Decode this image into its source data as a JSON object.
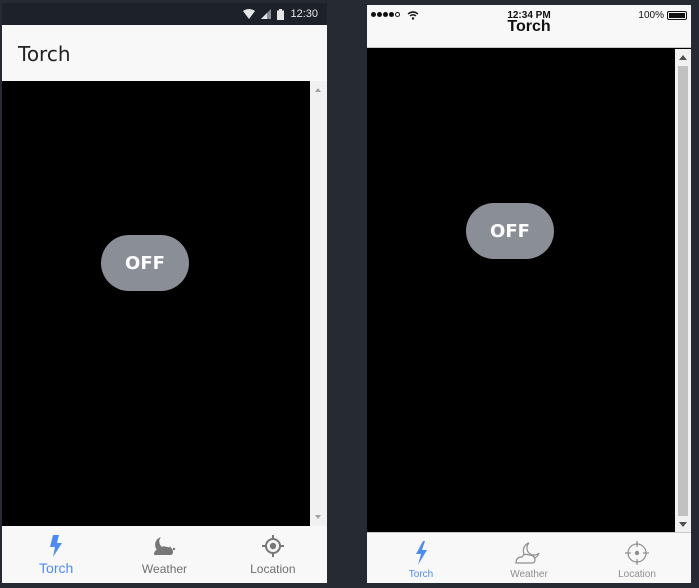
{
  "colors": {
    "accent": "#4e8cf0",
    "toggle_bg": "#8a8e96",
    "inactive_icon": "#777777",
    "desktop_bg": "#252a33"
  },
  "android": {
    "status_bar": {
      "time": "12:30",
      "icons": [
        "wifi-icon",
        "cell-signal-icon",
        "battery-icon"
      ]
    },
    "title": "Torch",
    "toggle_label": "OFF",
    "tabs": [
      {
        "label": "Torch",
        "icon": "lightning-bolt-icon",
        "active": true
      },
      {
        "label": "Weather",
        "icon": "weather-icon",
        "active": false
      },
      {
        "label": "Location",
        "icon": "location-target-icon",
        "active": false
      }
    ]
  },
  "ios": {
    "status_bar": {
      "time": "12:34 PM",
      "battery": "100%",
      "icons": [
        "signal-dots-icon",
        "wifi-icon",
        "battery-icon"
      ]
    },
    "title": "Torch",
    "toggle_label": "OFF",
    "tabs": [
      {
        "label": "Torch",
        "icon": "lightning-bolt-icon",
        "active": true
      },
      {
        "label": "Weather",
        "icon": "weather-icon",
        "active": false
      },
      {
        "label": "Location",
        "icon": "location-target-icon",
        "active": false
      }
    ]
  }
}
